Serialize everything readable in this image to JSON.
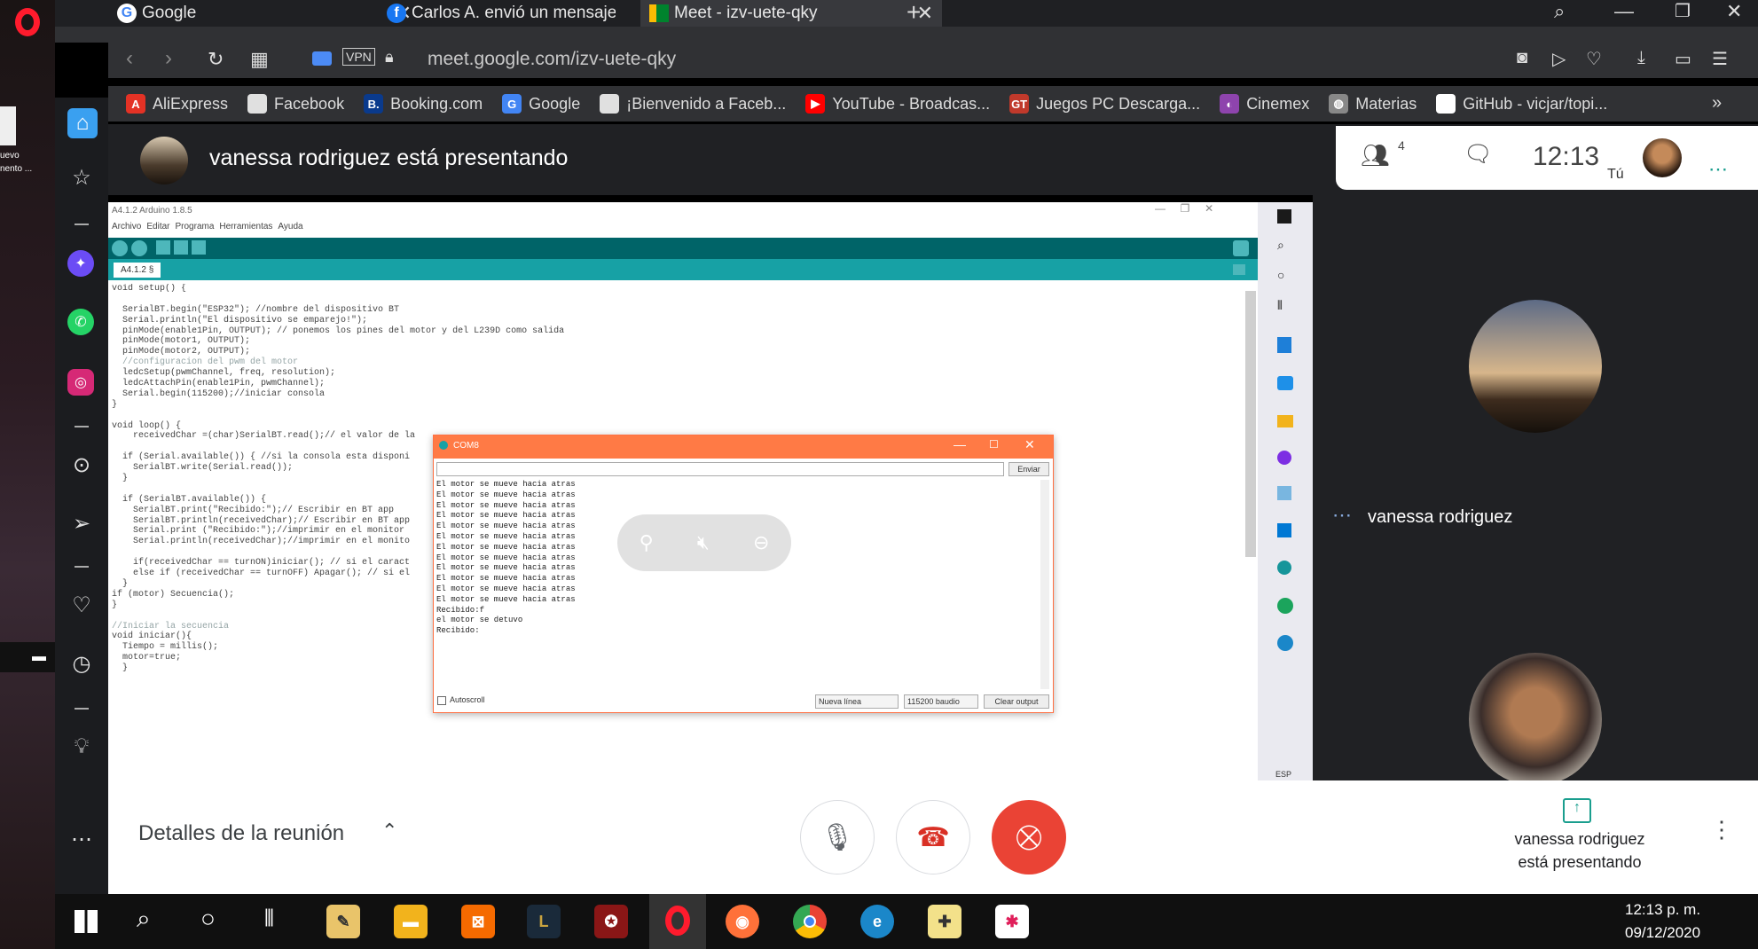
{
  "browser": {
    "tabs": [
      {
        "label": "Google",
        "icon": "google-icon",
        "active": false
      },
      {
        "label": "Carlos A. envió un mensaje",
        "icon": "facebook-icon",
        "active": false
      },
      {
        "label": "Meet - izv-uete-qky",
        "icon": "meet-icon",
        "active": true
      }
    ],
    "new_tab": "+",
    "url": "meet.google.com/izv-uete-qky",
    "vpn": "VPN",
    "bookmarks": [
      {
        "label": "AliExpress",
        "color": "#e43225",
        "glyph": "A"
      },
      {
        "label": "Facebook",
        "color": "#e0e0e0",
        "glyph": ""
      },
      {
        "label": "Booking.com",
        "color": "#0a3a8c",
        "glyph": "B."
      },
      {
        "label": "Google",
        "color": "#4285f4",
        "glyph": "G"
      },
      {
        "label": "¡Bienvenido a Faceb...",
        "color": "#e0e0e0",
        "glyph": ""
      },
      {
        "label": "YouTube - Broadcas...",
        "color": "#ff0000",
        "glyph": "▶"
      },
      {
        "label": "Juegos PC Descarga...",
        "color": "#c0392b",
        "glyph": "GT"
      },
      {
        "label": "Cinemex",
        "color": "#8e44ad",
        "glyph": "◐"
      },
      {
        "label": "Materias",
        "color": "#888",
        "glyph": "◍"
      },
      {
        "label": "GitHub - vicjar/topi...",
        "color": "#fff",
        "glyph": "◉"
      }
    ]
  },
  "desktop": {
    "left_icon_label": "uevo\nnento ..."
  },
  "meet": {
    "presenter_banner": "vanessa rodriguez está presentando",
    "participants_count": "4",
    "time": "12:13",
    "you_label": "Tú",
    "tile_name": "vanessa rodriguez",
    "meeting_details": "Detalles de la reunión",
    "presenting_line1": "vanessa rodriguez",
    "presenting_line2": "está presentando"
  },
  "arduino": {
    "title": "A4.1.2 Arduino 1.8.5",
    "menu": [
      "Archivo",
      "Editar",
      "Programa",
      "Herramientas",
      "Ayuda"
    ],
    "tab": "A4.1.2 §",
    "code": [
      "void setup() {",
      "",
      "  SerialBT.begin(\"ESP32\"); //nombre del dispositivo BT",
      "  Serial.println(\"El dispositivo se emparejo!\");",
      "  pinMode(enable1Pin, OUTPUT); // ponemos los pines del motor y del L239D como salida",
      "  pinMode(motor1, OUTPUT);",
      "  pinMode(motor2, OUTPUT);",
      "  //configuracion del pwm del motor",
      "  ledcSetup(pwmChannel, freq, resolution);",
      "  ledcAttachPin(enable1Pin, pwmChannel);",
      "  Serial.begin(115200);//iniciar consola",
      "}",
      "",
      "void loop() {",
      "    receivedChar =(char)SerialBT.read();// el valor de la",
      "",
      "  if (Serial.available()) { //si la consola esta disponi",
      "    SerialBT.write(Serial.read());",
      "  }",
      "",
      "  if (SerialBT.available()) {",
      "    SerialBT.print(\"Recibido:\");// Escribir en BT app",
      "    SerialBT.println(receivedChar);// Escribir en BT app",
      "    Serial.print (\"Recibido:\");//imprimir en el monitor",
      "    Serial.println(receivedChar);//imprimir en el monito",
      "",
      "    if(receivedChar == turnON)iniciar(); // si el caract",
      "    else if (receivedChar == turnOFF) Apagar(); // si el",
      "  }",
      "if (motor) Secuencia();",
      "}",
      "",
      "//Iniciar la secuencia",
      "void iniciar(){",
      "  Tiempo = millis();",
      "  motor=true;",
      "  }"
    ]
  },
  "serial_monitor": {
    "title": "COM8",
    "send_button": "Enviar",
    "output": [
      "El motor se mueve hacia atras",
      "El motor se mueve hacia atras",
      "El motor se mueve hacia atras",
      "El motor se mueve hacia atras",
      "El motor se mueve hacia atras",
      "El motor se mueve hacia atras",
      "El motor se mueve hacia atras",
      "El motor se mueve hacia atras",
      "El motor se mueve hacia atras",
      "El motor se mueve hacia atras",
      "El motor se mueve hacia atras",
      "El motor se mueve hacia atras",
      "Recibido:f",
      "el motor se detuvo",
      "Recibido:"
    ],
    "autoscroll": "Autoscroll",
    "line_ending": "Nueva línea",
    "baud": "115200 baudio",
    "clear": "Clear output"
  },
  "remote_tray": {
    "lang": "ESP"
  },
  "taskbar": {
    "time": "12:13 p. m.",
    "date": "09/12/2020"
  }
}
